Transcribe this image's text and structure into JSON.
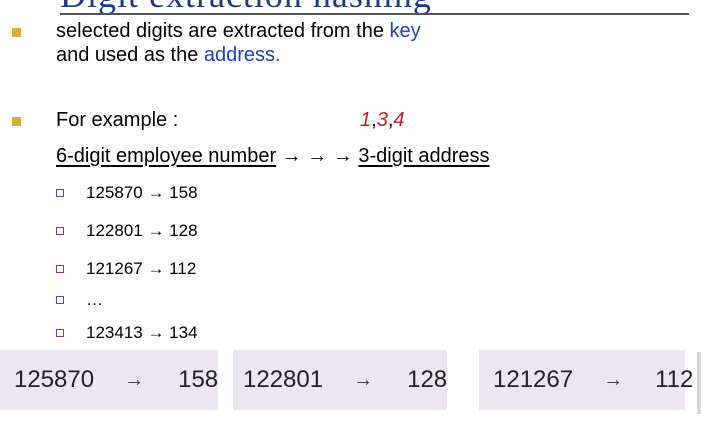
{
  "title_fragment": "Digit extraction hashing",
  "bullets": {
    "first_line1_pre": "selected digits are extracted from the ",
    "first_line1_key": "key",
    "first_line2_pre": "and used as the ",
    "first_line2_addr": "address.",
    "example_label": "For example :",
    "example_digits": [
      "1",
      ",",
      "3",
      ",",
      "4"
    ],
    "mapping_left": "6-digit employee number",
    "mapping_arrows": " → → → ",
    "mapping_right": "3-digit address"
  },
  "sub_items": [
    {
      "text": "125870 → 158"
    },
    {
      "text": "122801 → 128"
    },
    {
      "text": "121267 → 112"
    },
    {
      "text": "…"
    },
    {
      "text": "123413 → 134"
    }
  ],
  "cards": [
    {
      "from": "125870",
      "arrow": "→",
      "to": "158"
    },
    {
      "from": "122801",
      "arrow": "→",
      "to": "128"
    },
    {
      "from": "121267",
      "arrow": "→",
      "to": "112"
    }
  ],
  "colors": {
    "bullet": "#d9ae39",
    "key_blue": "#1f3fbf",
    "digits_red": "#c0201e",
    "card_bg": "#ece6f1"
  }
}
